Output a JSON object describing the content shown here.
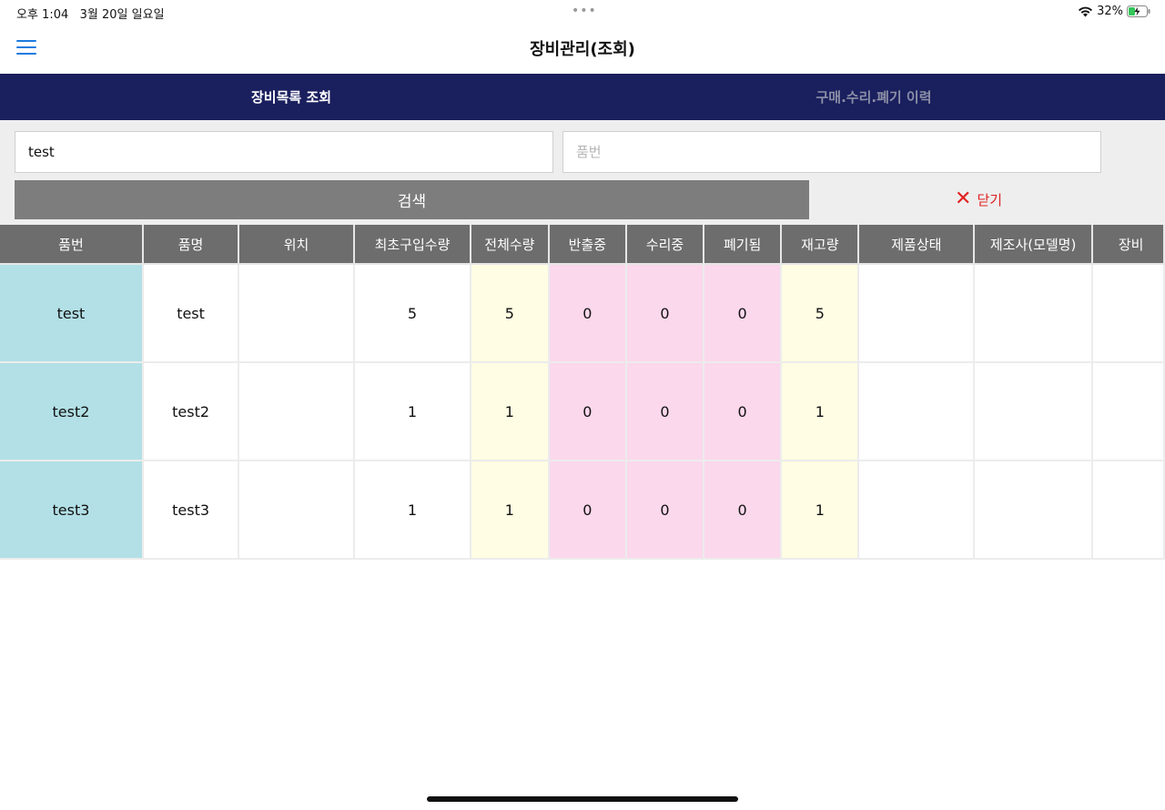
{
  "status_bar": {
    "time": "오후 1:04",
    "date": "3월 20일 일요일",
    "dots": "•••",
    "battery_percent": "32%",
    "icons": [
      "wifi-icon",
      "battery-charging-icon"
    ]
  },
  "nav": {
    "title": "장비관리(조회)",
    "menu_icon": "hamburger-menu-icon",
    "accent_color": "#1a7be0"
  },
  "tabs": [
    {
      "label": "장비목록 조회",
      "active": true
    },
    {
      "label": "구매.수리.폐기 이력",
      "active": false
    }
  ],
  "search": {
    "name_value": "test",
    "code_placeholder": "품번",
    "search_label": "검색",
    "close_label": "닫기",
    "close_icon": "close-x-icon"
  },
  "table": {
    "headers": [
      "품번",
      "품명",
      "위치",
      "최초구입수량",
      "전체수량",
      "반출중",
      "수리중",
      "폐기됨",
      "재고량",
      "제품상태",
      "제조사(모델명)",
      "장비"
    ],
    "rows": [
      {
        "code": "test",
        "name": "test",
        "location": "",
        "initial_qty": "5",
        "total_qty": "5",
        "out": "0",
        "repair": "0",
        "disposed": "0",
        "stock": "5",
        "status": "",
        "maker": "",
        "extra": ""
      },
      {
        "code": "test2",
        "name": "test2",
        "location": "",
        "initial_qty": "1",
        "total_qty": "1",
        "out": "0",
        "repair": "0",
        "disposed": "0",
        "stock": "1",
        "status": "",
        "maker": "",
        "extra": ""
      },
      {
        "code": "test3",
        "name": "test3",
        "location": "",
        "initial_qty": "1",
        "total_qty": "1",
        "out": "0",
        "repair": "0",
        "disposed": "0",
        "stock": "1",
        "status": "",
        "maker": "",
        "extra": ""
      }
    ]
  },
  "colors": {
    "tab_bar": "#1a1f5e",
    "code_cell": "#b2e0e6",
    "qty_cell": "#fffde3",
    "alert_cell": "#fbd8ec",
    "close_red": "#e02020"
  }
}
